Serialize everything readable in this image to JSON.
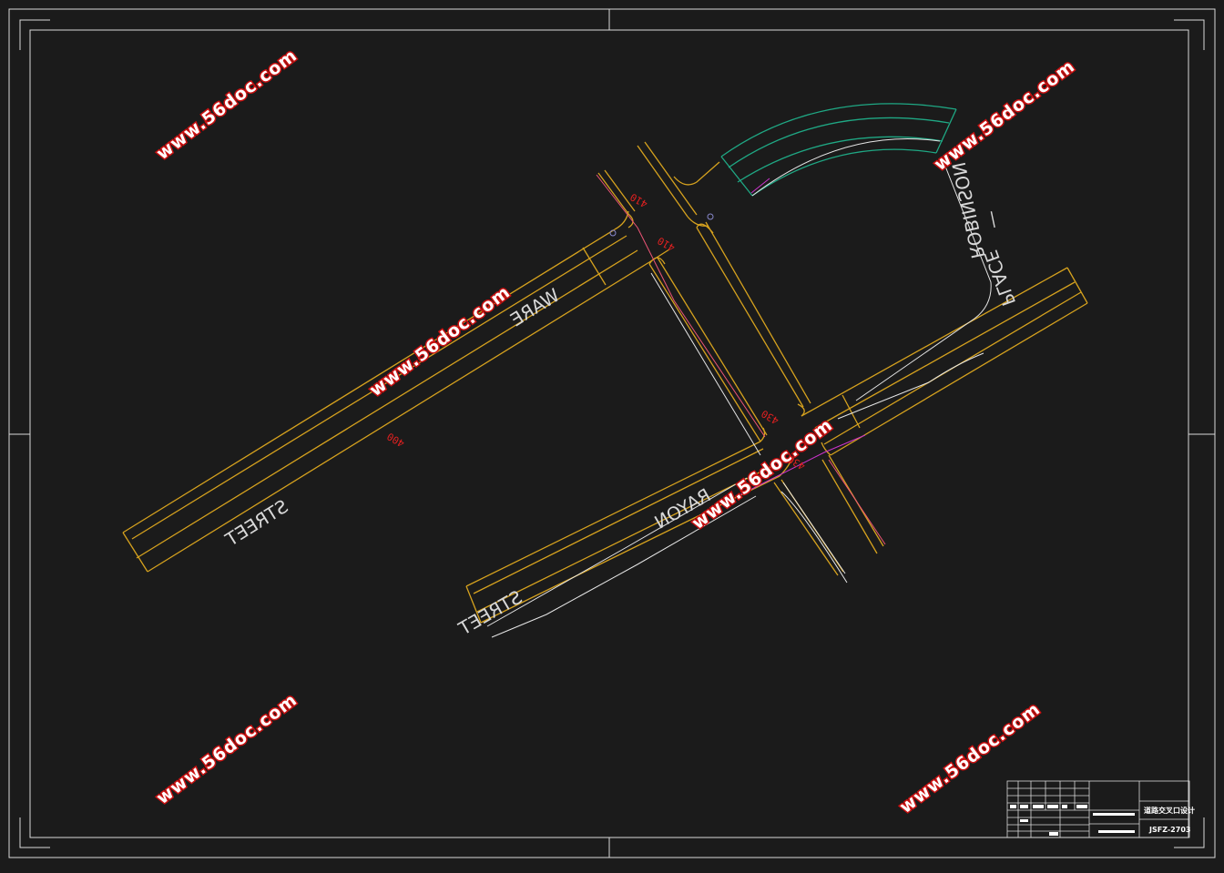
{
  "colors": {
    "background": "#1b1b1b",
    "frame": "#d9d9d9",
    "road": "#d6a21e",
    "road_inner": "#e6bb3a",
    "curve": "#1fa884",
    "magenta": "#cc33cc",
    "pink": "#ee5577",
    "white_line": "#e6e6e6",
    "dimension": "#e02020",
    "watermark_fill": "#ffffff",
    "watermark_stroke": "#c81010"
  },
  "street_labels": {
    "ware": "WARE",
    "street_1": "STREET",
    "rayon": "RAYON",
    "street_2": "STREET",
    "robinson": "ROBINSON",
    "dash": "—",
    "place": "PLACE"
  },
  "dimensions": {
    "d_410_top": "410",
    "d_410_mid": "410",
    "d_400": "400",
    "d_430_a": "430",
    "d_430_b": "430"
  },
  "watermark": "www.56doc.com",
  "title_block": {
    "title": "道路交叉口设计",
    "drawing_no": "JSFZ-2703"
  }
}
